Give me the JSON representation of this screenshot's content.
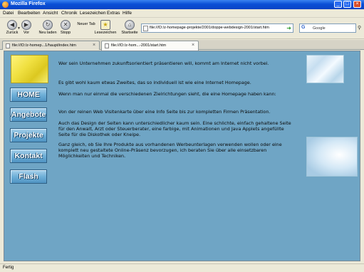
{
  "window": {
    "title": "Mozilla Firefox"
  },
  "menu": [
    "Datei",
    "Bearbeiten",
    "Ansicht",
    "Chronik",
    "Lesezeichen",
    "Extras",
    "Hilfe"
  ],
  "toolbar": {
    "back": "Zurück",
    "forward": "Vor",
    "reload": "Neu laden",
    "stop": "Stopp",
    "newtab": "Neuer Tab",
    "bookmarks": "Lesezeichen",
    "home": "Startseite"
  },
  "urlbar": {
    "value": "file:///D:/z-homepage-projekte/2001/doppe-webdesign-2001/start.htm"
  },
  "search": {
    "engine_label": "Google"
  },
  "tabs": [
    {
      "title": "file:///D:/z-homep...1/haupt/index.htm",
      "active": false
    },
    {
      "title": "file:///D:/z-hom...-2001/start.htm",
      "active": true
    }
  ],
  "site_nav": [
    "HOME",
    "Angebote",
    "Projekte",
    "Kontakt",
    "Flash"
  ],
  "page_text": {
    "p1": "Wer sein Unternehmen zukunftsorientiert präsentieren will, kommt am Internet nicht vorbei.",
    "p2": "Es gibt wohl kaum etwas Zweites, das so individuell ist wie eine Internet Homepage.",
    "p3": "Wenn man nur einmal die verschiedenen Zielrichtungen sieht, die eine Homepage haben kann:",
    "p4": "Von der reinen Web Visitenkarte über eine Info Seite bis zur kompletten Firmen Präsentation.",
    "p5": "Auch das Design der Seiten kann unterschiedlicher kaum sein. Eine schlichte, einfach gehaltene Seite für den Anwalt, Arzt oder Steuerberater, eine farbige, mit Animationen und Java Applets angefüllte Seite für die Diskothek oder Kneipe.",
    "p6": "Ganz gleich, ob Sie Ihre Produkte aus vorhandenen Werbeunterlagen verwenden wollen oder eine komplett neu gestaltete Online-Präsenz bevorzugen, ich beraten Sie über alle einsetzbaren Möglichkeiten und Techniken."
  },
  "status": {
    "text": "Fertig"
  },
  "colors": {
    "page_bg": "#6fa5c5",
    "button_face": "#6fb0d8",
    "chrome": "#ece9d8"
  }
}
